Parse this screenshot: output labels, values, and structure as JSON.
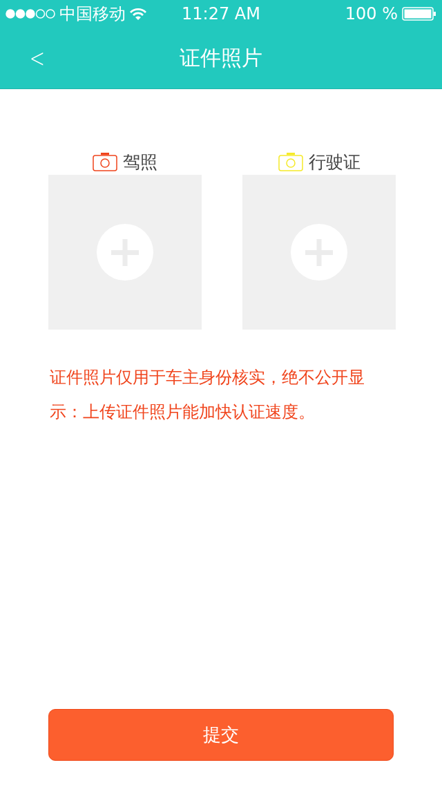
{
  "status_bar": {
    "carrier": "中国移动",
    "time": "11:27 AM",
    "battery": "100 %"
  },
  "nav_bar": {
    "back": "<",
    "title": "证件照片"
  },
  "uploads": [
    {
      "label": "驾照",
      "color": "#f0441c"
    },
    {
      "label": "行驶证",
      "color": "#f5ea2a"
    }
  ],
  "notice": "证件照片仅用于车主身份核实，绝不公开显示：上传证件照片能加快认证速度。",
  "submit_button": "提交"
}
